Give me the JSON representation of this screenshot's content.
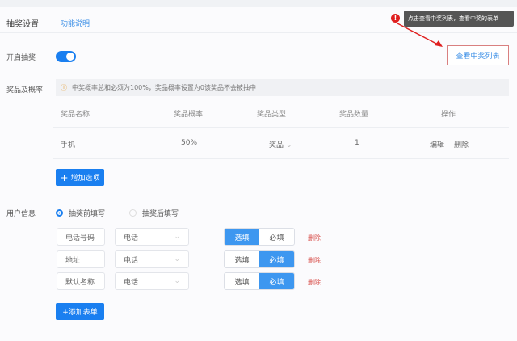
{
  "header": {
    "title": "抽奖设置",
    "help_link": "功能说明"
  },
  "tooltip": {
    "badge": "!",
    "text": "点击查看中奖列表，查看中奖的表单"
  },
  "view_winners_button": "查看中奖列表",
  "enable": {
    "label": "开启抽奖",
    "on": true
  },
  "prizes": {
    "label": "奖品及概率",
    "notice": "中奖概率总和必须为100%，奖品概率设置为0该奖品不会被抽中",
    "columns": [
      "奖品名称",
      "奖品概率",
      "奖品类型",
      "奖品数量",
      "操作"
    ],
    "rows": [
      {
        "name": "手机",
        "probability": "50%",
        "type": "奖品",
        "quantity": "1",
        "edit": "编辑",
        "delete": "删除"
      }
    ],
    "add_button": "增加选项"
  },
  "user_info": {
    "label": "用户信息",
    "options": [
      {
        "label": "抽奖前填写",
        "selected": true
      },
      {
        "label": "抽奖后填写",
        "selected": false
      }
    ],
    "fields": [
      {
        "name": "电话号码",
        "type": "电话",
        "optional": "选填",
        "required": "必填",
        "selected": "optional",
        "delete": "删除"
      },
      {
        "name": "地址",
        "type": "电话",
        "optional": "选填",
        "required": "必填",
        "selected": "required",
        "delete": "删除"
      },
      {
        "name": "默认名称",
        "type": "电话",
        "optional": "选填",
        "required": "必填",
        "selected": "required",
        "delete": "删除"
      }
    ],
    "add_button": "+添加表单"
  }
}
